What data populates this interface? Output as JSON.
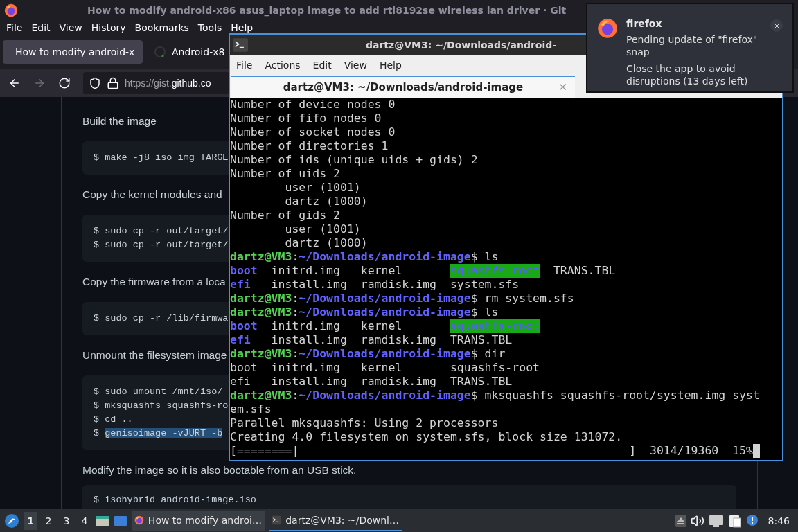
{
  "browser": {
    "title": "How to modify android-x86 asus_laptop image to add rtl8192se wireless lan driver · Git",
    "menu": [
      "File",
      "Edit",
      "View",
      "History",
      "Bookmarks",
      "Tools",
      "Help"
    ],
    "tabs": [
      {
        "label": "How to modify android-x",
        "selected": true,
        "kind": "github"
      },
      {
        "label": "Android-x8",
        "selected": false,
        "kind": "loading"
      }
    ],
    "url": {
      "prefix": "https://gist.",
      "domain": "github.co"
    },
    "blocks": [
      {
        "kind": "text",
        "text": "Build the image"
      },
      {
        "kind": "code",
        "lines": [
          {
            "text": "$ make -j8 iso_img TARGE"
          }
        ]
      },
      {
        "kind": "text",
        "text": "Copy the kernel modules and"
      },
      {
        "kind": "code",
        "lines": [
          {
            "text": "$ sudo cp -r out/target/"
          },
          {
            "text": "$ sudo cp -r out/target/"
          }
        ]
      },
      {
        "kind": "text",
        "text": "Copy the firmware from a loca"
      },
      {
        "kind": "code",
        "lines": [
          {
            "text": "$ sudo cp -r /lib/firmwa"
          }
        ]
      },
      {
        "kind": "text",
        "text": "Unmount the filesystem image"
      },
      {
        "kind": "code",
        "lines": [
          {
            "text": "$ sudo umount /mnt/iso/"
          },
          {
            "text": "$ mksquashfs squashfs-ro"
          },
          {
            "text": "$ cd .."
          },
          {
            "text": "$ ",
            "selection": "genisoimage -vJURT -b"
          }
        ]
      },
      {
        "kind": "text",
        "text": "Modify the image so it is also bootable from an USB stick."
      },
      {
        "kind": "code",
        "lines": [
          {
            "text": "$ isohybrid android-image.iso"
          }
        ]
      }
    ]
  },
  "terminal": {
    "title": "dartz@VM3: ~/Downloads/android-",
    "menu": [
      "File",
      "Actions",
      "Edit",
      "View",
      "Help"
    ],
    "tab": "dartz@VM3: ~/Downloads/android-image",
    "lines": [
      [
        {
          "kind": "plain",
          "text": "Number of device nodes 0"
        }
      ],
      [
        {
          "kind": "plain",
          "text": "Number of fifo nodes 0"
        }
      ],
      [
        {
          "kind": "plain",
          "text": "Number of socket nodes 0"
        }
      ],
      [
        {
          "kind": "plain",
          "text": "Number of directories 1"
        }
      ],
      [
        {
          "kind": "plain",
          "text": "Number of ids (unique uids + gids) 2"
        }
      ],
      [
        {
          "kind": "plain",
          "text": "Number of uids 2"
        }
      ],
      [
        {
          "kind": "plain",
          "text": "        user (1001)"
        }
      ],
      [
        {
          "kind": "plain",
          "text": "        dartz (1000)"
        }
      ],
      [
        {
          "kind": "plain",
          "text": "Number of gids 2"
        }
      ],
      [
        {
          "kind": "plain",
          "text": "        user (1001)"
        }
      ],
      [
        {
          "kind": "plain",
          "text": "        dartz (1000)"
        }
      ],
      [
        {
          "kind": "user",
          "text": "dartz@VM3"
        },
        {
          "kind": "plain",
          "text": ":"
        },
        {
          "kind": "path",
          "text": "~/Downloads/android-image"
        },
        {
          "kind": "plain",
          "text": "$ ls"
        }
      ],
      [
        {
          "kind": "dir",
          "text": "boot"
        },
        {
          "kind": "plain",
          "text": "  initrd.img   kernel       "
        },
        {
          "kind": "dirhl",
          "text": "squashfs-root"
        },
        {
          "kind": "plain",
          "text": "  TRANS.TBL"
        }
      ],
      [
        {
          "kind": "dir",
          "text": "efi"
        },
        {
          "kind": "plain",
          "text": "   install.img  ramdisk.img  system.sfs"
        }
      ],
      [
        {
          "kind": "user",
          "text": "dartz@VM3"
        },
        {
          "kind": "plain",
          "text": ":"
        },
        {
          "kind": "path",
          "text": "~/Downloads/android-image"
        },
        {
          "kind": "plain",
          "text": "$ rm system.sfs"
        }
      ],
      [
        {
          "kind": "user",
          "text": "dartz@VM3"
        },
        {
          "kind": "plain",
          "text": ":"
        },
        {
          "kind": "path",
          "text": "~/Downloads/android-image"
        },
        {
          "kind": "plain",
          "text": "$ ls"
        }
      ],
      [
        {
          "kind": "dir",
          "text": "boot"
        },
        {
          "kind": "plain",
          "text": "  initrd.img   kernel       "
        },
        {
          "kind": "dirhl",
          "text": "squashfs-root"
        }
      ],
      [
        {
          "kind": "dir",
          "text": "efi"
        },
        {
          "kind": "plain",
          "text": "   install.img  ramdisk.img  TRANS.TBL"
        }
      ],
      [
        {
          "kind": "user",
          "text": "dartz@VM3"
        },
        {
          "kind": "plain",
          "text": ":"
        },
        {
          "kind": "path",
          "text": "~/Downloads/android-image"
        },
        {
          "kind": "plain",
          "text": "$ dir"
        }
      ],
      [
        {
          "kind": "plain",
          "text": "boot  initrd.img   kernel       squashfs-root"
        }
      ],
      [
        {
          "kind": "plain",
          "text": "efi   install.img  ramdisk.img  TRANS.TBL"
        }
      ],
      [
        {
          "kind": "user",
          "text": "dartz@VM3"
        },
        {
          "kind": "plain",
          "text": ":"
        },
        {
          "kind": "path",
          "text": "~/Downloads/android-image"
        },
        {
          "kind": "plain",
          "text": "$ mksquashfs squashfs-root/system.img syst"
        }
      ],
      [
        {
          "kind": "plain",
          "text": "em.sfs"
        }
      ],
      [
        {
          "kind": "plain",
          "text": "Parallel mksquashfs: Using 2 processors"
        }
      ],
      [
        {
          "kind": "plain",
          "text": "Creating 4.0 filesystem on system.sfs, block size 131072."
        }
      ],
      [
        {
          "kind": "plain",
          "text": "[========|                                                ]  3014/19360  15%"
        },
        {
          "kind": "cursor"
        }
      ]
    ]
  },
  "notification": {
    "app": "firefox",
    "summary": "Pending update of \"firefox\" snap",
    "body": "Close the app to avoid disruptions (13 days left)"
  },
  "taskbar": {
    "workspaces": [
      {
        "label": "1",
        "selected": true
      },
      {
        "label": "2",
        "selected": false
      },
      {
        "label": "3",
        "selected": false
      },
      {
        "label": "4",
        "selected": false
      }
    ],
    "windows": [
      {
        "label": "How to modify androi…",
        "selected": false,
        "kind": "browser"
      },
      {
        "label": "dartz@VM3: ~/Downl…",
        "selected": true,
        "kind": "terminal"
      }
    ],
    "clock": "8:46"
  }
}
